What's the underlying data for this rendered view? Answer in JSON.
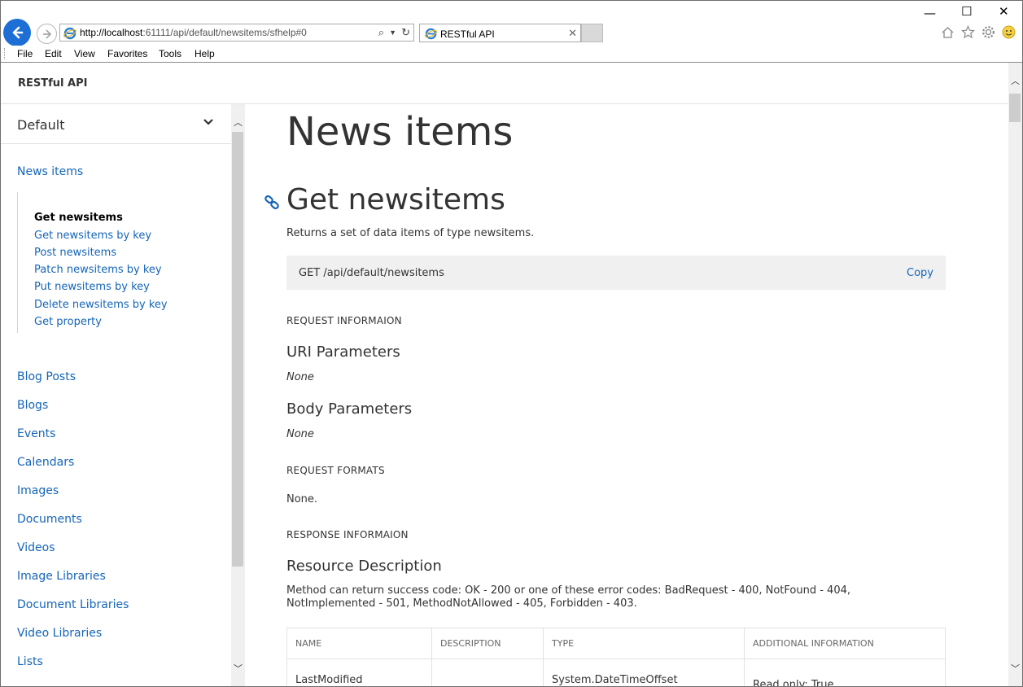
{
  "browser": {
    "address_host": "http://localhost",
    "address_rest": ":61111/api/default/newsitems/sfhelp#0",
    "tab_title": "RESTful API",
    "menu": [
      "File",
      "Edit",
      "View",
      "Favorites",
      "Tools",
      "Help"
    ]
  },
  "site": {
    "header_title": "RESTful API"
  },
  "sidebar": {
    "selector_value": "Default",
    "current_section": "News items",
    "subitems": [
      "Get newsitems",
      "Get newsitems by key",
      "Post newsitems",
      "Patch newsitems by key",
      "Put newsitems by key",
      "Delete newsitems by key",
      "Get property"
    ],
    "sections": [
      "Blog Posts",
      "Blogs",
      "Events",
      "Calendars",
      "Images",
      "Documents",
      "Videos",
      "Image Libraries",
      "Document Libraries",
      "Video Libraries",
      "Lists"
    ]
  },
  "main": {
    "page_title": "News items",
    "section_title": "Get newsitems",
    "section_desc": "Returns a set of data items of type newsitems.",
    "endpoint": "GET /api/default/newsitems",
    "copy_label": "Copy",
    "request_info_caption": "REQUEST INFORMAION",
    "uri_params_title": "URI Parameters",
    "uri_params_value": "None",
    "body_params_title": "Body Parameters",
    "body_params_value": "None",
    "request_formats_caption": "REQUEST FORMATS",
    "request_formats_value": "None.",
    "response_info_caption": "RESPONSE INFORMAION",
    "resource_desc_title": "Resource Description",
    "resource_desc_text": "Method can return success code: OK - 200 or one of these error codes: BadRequest - 400, NotFound - 404, NotImplemented - 501, MethodNotAllowed - 405, Forbidden - 403.",
    "table": {
      "headers": [
        "NAME",
        "DESCRIPTION",
        "TYPE",
        "ADDITIONAL INFORMATION"
      ],
      "rows": [
        [
          "LastModified",
          "",
          "System.DateTimeOffset",
          "Read only: True"
        ]
      ]
    }
  },
  "colors": {
    "link": "#1565b8",
    "back_button": "#1d6fd6",
    "code_bg": "#f0f0f0"
  }
}
